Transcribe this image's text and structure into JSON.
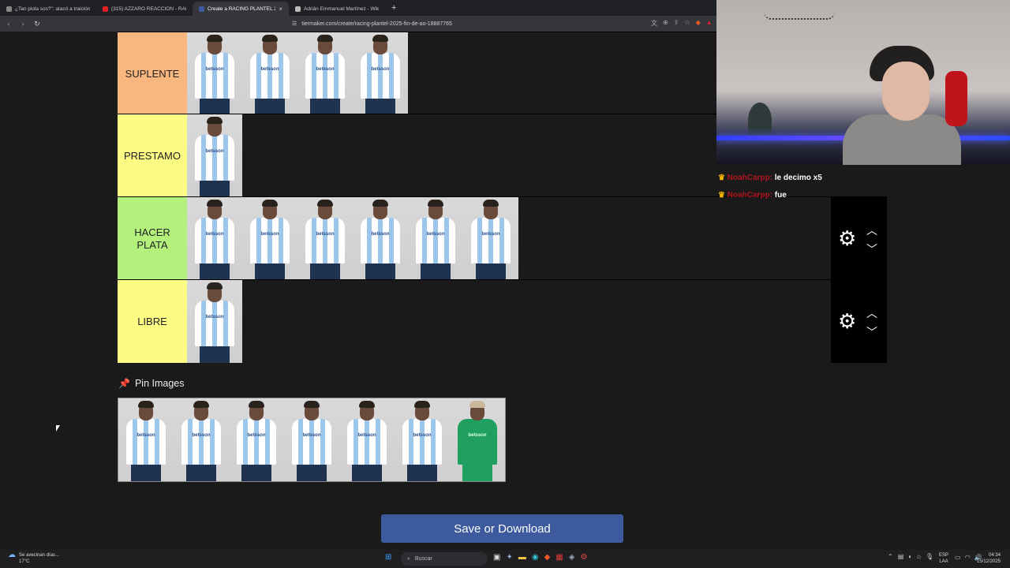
{
  "browser": {
    "tabs": [
      {
        "title": "¿Tan piola sos?\": atacó a traición a u",
        "active": false,
        "color": "#888888"
      },
      {
        "title": "(315) AZZARO REACCIÓN - RACING",
        "active": false,
        "color": "#e02020"
      },
      {
        "title": "Create a RACING PLANTEL 2025",
        "active": true,
        "color": "#3d5a9e"
      },
      {
        "title": "Adrián Emmanuel Martínez - Wikipe",
        "active": false,
        "color": "#bbbbbb"
      }
    ],
    "url": "tiermaker.com/create/racing-plantel-2025-fin-de-ao-18887765"
  },
  "tiers": [
    {
      "label": "SUPLENTE",
      "color": "#f8b77e",
      "count": 4
    },
    {
      "label": "PRESTAMO",
      "color": "#fcfc84",
      "count": 1
    },
    {
      "label": "HACER PLATA",
      "color": "#b4f17c",
      "count": 6
    },
    {
      "label": "LIBRE",
      "color": "#fcfc84",
      "count": 1
    }
  ],
  "card_logo": "betsson",
  "pin": {
    "title": "Pin Images",
    "count": 7,
    "goalkeeper_index": 6
  },
  "save_label": "Save or Download",
  "chat": [
    {
      "user": "NoahCarpp:",
      "message": "le decimo x5"
    },
    {
      "user": "NoahCarpp:",
      "message": "fue"
    }
  ],
  "taskbar": {
    "weather_line1": "Se avecinan días...",
    "weather_line2": "17°C",
    "search_placeholder": "Buscar",
    "lang_line1": "ESP",
    "lang_line2": "LAA",
    "time": "04:34",
    "date": "15/12/2025"
  }
}
